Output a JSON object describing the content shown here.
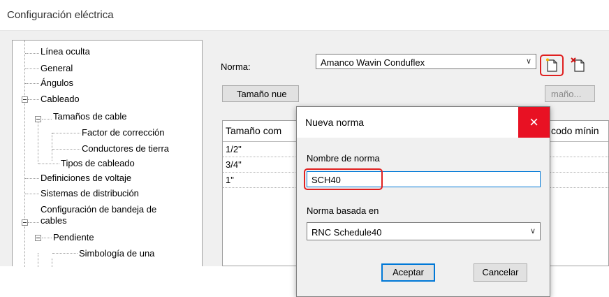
{
  "window": {
    "title": "Configuración eléctrica"
  },
  "tree": {
    "items": [
      {
        "label": "Línea oculta"
      },
      {
        "label": "General"
      },
      {
        "label": "Ángulos"
      },
      {
        "label": "Cableado"
      },
      {
        "label": "Tamaños de cable"
      },
      {
        "label": "Factor de corrección"
      },
      {
        "label": "Conductores de tierra"
      },
      {
        "label": "Tipos de cableado"
      },
      {
        "label": "Definiciones de voltaje"
      },
      {
        "label": "Sistemas de distribución"
      },
      {
        "label": "Configuración de bandeja de"
      },
      {
        "label": "cables"
      },
      {
        "label": "Pendiente"
      },
      {
        "label": "Simbología de una"
      }
    ]
  },
  "norma": {
    "label": "Norma:",
    "selected": "Amanco Wavin Conduflex",
    "new_icon": "new-document-icon",
    "delete_icon": "delete-document-icon"
  },
  "size_buttons": {
    "new_size": "Tamaño nue",
    "modify_size": "maño..."
  },
  "grid": {
    "headers": [
      "Tamaño com",
      "codo mínin"
    ],
    "rows": [
      "1/2\"",
      "3/4\"",
      "1\""
    ]
  },
  "dialog": {
    "title": "Nueva norma",
    "close_label": "×",
    "name_label": "Nombre de norma",
    "name_value": "SCH40",
    "based_label": "Norma basada en",
    "based_value": "RNC Schedule40",
    "ok_label": "Aceptar",
    "cancel_label": "Cancelar"
  },
  "colors": {
    "highlight": "#e02020",
    "close_button": "#e81123",
    "focus_border": "#0078d7"
  }
}
